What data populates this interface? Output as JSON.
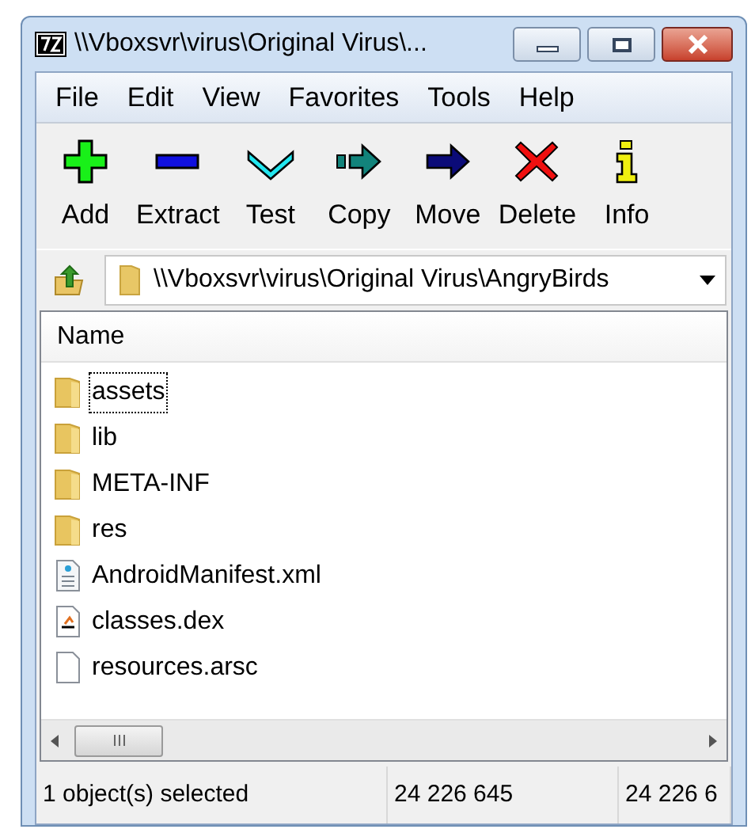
{
  "window": {
    "title": "\\\\Vboxsvr\\virus\\Original Virus\\..."
  },
  "menu": [
    "File",
    "Edit",
    "View",
    "Favorites",
    "Tools",
    "Help"
  ],
  "toolbar": [
    {
      "label": "Add",
      "kind": "add"
    },
    {
      "label": "Extract",
      "kind": "extract"
    },
    {
      "label": "Test",
      "kind": "test"
    },
    {
      "label": "Copy",
      "kind": "copy"
    },
    {
      "label": "Move",
      "kind": "move"
    },
    {
      "label": "Delete",
      "kind": "delete"
    },
    {
      "label": "Info",
      "kind": "info"
    }
  ],
  "address": {
    "value": "\\\\Vboxsvr\\virus\\Original Virus\\AngryBirds"
  },
  "list": {
    "columns": [
      "Name"
    ],
    "rows": [
      {
        "name": "assets",
        "kind": "folder",
        "focused": true
      },
      {
        "name": "lib",
        "kind": "folder",
        "focused": false
      },
      {
        "name": "META-INF",
        "kind": "folder",
        "focused": false
      },
      {
        "name": "res",
        "kind": "folder",
        "focused": false
      },
      {
        "name": "AndroidManifest.xml",
        "kind": "xml",
        "focused": false
      },
      {
        "name": "classes.dex",
        "kind": "dex",
        "focused": false
      },
      {
        "name": "resources.arsc",
        "kind": "file",
        "focused": false
      }
    ]
  },
  "status_bar": [
    "1 object(s) selected",
    "24 226 645",
    "24 226 6"
  ]
}
